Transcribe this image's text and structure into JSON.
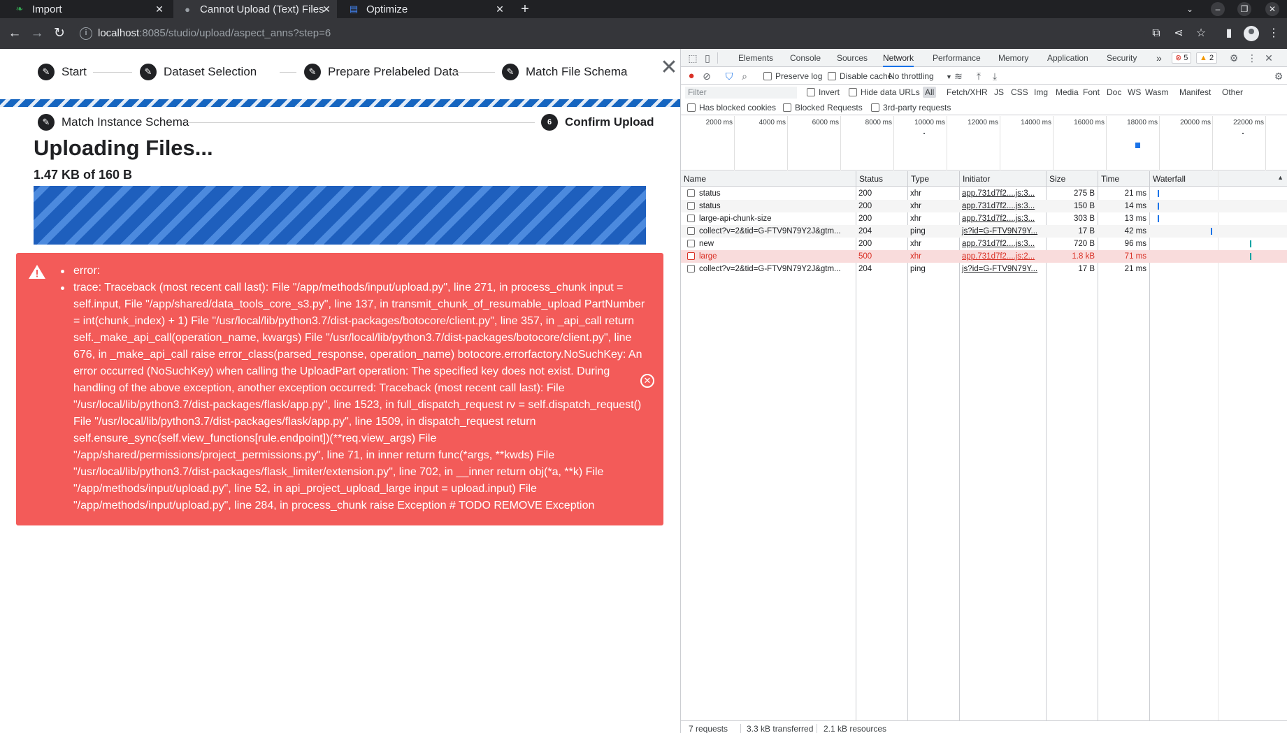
{
  "browser": {
    "tabs": [
      {
        "title": "Import",
        "active": false
      },
      {
        "title": "Cannot Upload (Text) Files",
        "active": true
      },
      {
        "title": "Optimize",
        "active": false
      }
    ],
    "url_host": "localhost",
    "url_rest": ":8085/studio/upload/aspect_anns?step=6"
  },
  "wizard": {
    "steps": [
      {
        "label": "Start",
        "icon": "✎"
      },
      {
        "label": "Dataset Selection",
        "icon": "✎"
      },
      {
        "label": "Prepare Prelabeled Data",
        "icon": "✎"
      },
      {
        "label": "Match File Schema",
        "icon": "✎"
      },
      {
        "label": "Match Instance Schema",
        "icon": "✎"
      },
      {
        "label": "Confirm Upload",
        "icon": "6"
      }
    ],
    "title": "Uploading Files...",
    "size_text": "1.47 KB of 160 B",
    "progress_fraction": 1.0
  },
  "error": {
    "line1": "error:",
    "line2": "trace: Traceback (most recent call last): File \"/app/methods/input/upload.py\", line 271, in process_chunk input = self.input, File \"/app/shared/data_tools_core_s3.py\", line 137, in transmit_chunk_of_resumable_upload PartNumber = int(chunk_index) + 1) File \"/usr/local/lib/python3.7/dist-packages/botocore/client.py\", line 357, in _api_call return self._make_api_call(operation_name, kwargs) File \"/usr/local/lib/python3.7/dist-packages/botocore/client.py\", line 676, in _make_api_call raise error_class(parsed_response, operation_name) botocore.errorfactory.NoSuchKey: An error occurred (NoSuchKey) when calling the UploadPart operation: The specified key does not exist. During handling of the above exception, another exception occurred: Traceback (most recent call last): File \"/usr/local/lib/python3.7/dist-packages/flask/app.py\", line 1523, in full_dispatch_request rv = self.dispatch_request() File \"/usr/local/lib/python3.7/dist-packages/flask/app.py\", line 1509, in dispatch_request return self.ensure_sync(self.view_functions[rule.endpoint])(**req.view_args) File \"/app/shared/permissions/project_permissions.py\", line 71, in inner return func(*args, **kwds) File \"/usr/local/lib/python3.7/dist-packages/flask_limiter/extension.py\", line 702, in __inner return obj(*a, **k) File \"/app/methods/input/upload.py\", line 52, in api_project_upload_large input = upload.input) File \"/app/methods/input/upload.py\", line 284, in process_chunk raise Exception # TODO REMOVE Exception"
  },
  "devtools": {
    "tabs": [
      "Elements",
      "Console",
      "Sources",
      "Network",
      "Performance",
      "Memory",
      "Application",
      "Security"
    ],
    "more": "»",
    "errors_badge": "5",
    "warnings_badge": "2",
    "toolbar": {
      "preserve_log": "Preserve log",
      "disable_cache": "Disable cache",
      "throttling": "No throttling"
    },
    "filter": {
      "placeholder": "Filter",
      "invert": "Invert",
      "hide_data_urls": "Hide data URLs",
      "types": [
        "All",
        "Fetch/XHR",
        "JS",
        "CSS",
        "Img",
        "Media",
        "Font",
        "Doc",
        "WS",
        "Wasm",
        "Manifest",
        "Other"
      ],
      "has_blocked_cookies": "Has blocked cookies",
      "blocked_requests": "Blocked Requests",
      "third_party": "3rd-party requests"
    },
    "timeline_ticks": [
      "2000 ms",
      "4000 ms",
      "6000 ms",
      "8000 ms",
      "10000 ms",
      "12000 ms",
      "14000 ms",
      "16000 ms",
      "18000 ms",
      "20000 ms",
      "22000 ms"
    ],
    "columns": [
      "Name",
      "Status",
      "Type",
      "Initiator",
      "Size",
      "Time",
      "Waterfall"
    ],
    "rows": [
      {
        "name": "status",
        "status": "200",
        "type": "xhr",
        "initiator": "app.731d7f2....js:3...",
        "size": "275 B",
        "time": "21 ms",
        "error": false
      },
      {
        "name": "status",
        "status": "200",
        "type": "xhr",
        "initiator": "app.731d7f2....js:3...",
        "size": "150 B",
        "time": "14 ms",
        "error": false
      },
      {
        "name": "large-api-chunk-size",
        "status": "200",
        "type": "xhr",
        "initiator": "app.731d7f2....js:3...",
        "size": "303 B",
        "time": "13 ms",
        "error": false
      },
      {
        "name": "collect?v=2&tid=G-FTV9N79Y2J&gtm...",
        "status": "204",
        "type": "ping",
        "initiator": "js?id=G-FTV9N79Y...",
        "size": "17 B",
        "time": "42 ms",
        "error": false
      },
      {
        "name": "new",
        "status": "200",
        "type": "xhr",
        "initiator": "app.731d7f2....js:3...",
        "size": "720 B",
        "time": "96 ms",
        "error": false
      },
      {
        "name": "large",
        "status": "500",
        "type": "xhr",
        "initiator": "app.731d7f2....js:2...",
        "size": "1.8 kB",
        "time": "71 ms",
        "error": true
      },
      {
        "name": "collect?v=2&tid=G-FTV9N79Y2J&gtm...",
        "status": "204",
        "type": "ping",
        "initiator": "js?id=G-FTV9N79Y...",
        "size": "17 B",
        "time": "21 ms",
        "error": false
      }
    ],
    "status": {
      "requests": "7 requests",
      "transferred": "3.3 kB transferred",
      "resources": "2.1 kB resources"
    }
  },
  "colors": {
    "accent": "#1a73e8",
    "error_bg": "#f35b59",
    "progress": "#1e5fbd"
  }
}
